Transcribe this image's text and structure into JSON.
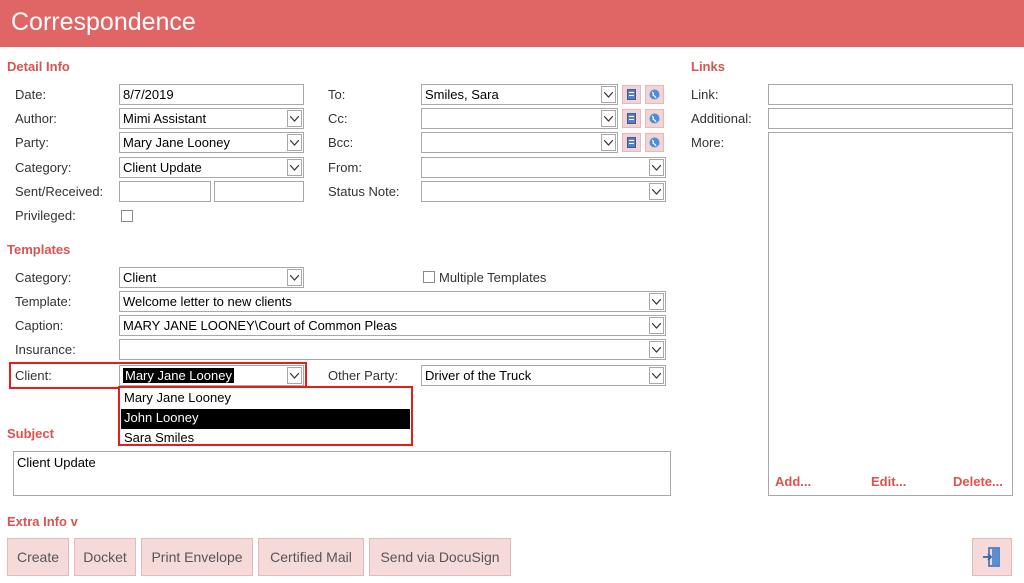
{
  "window": {
    "title": "Correspondence"
  },
  "detail": {
    "heading": "Detail Info",
    "date_label": "Date:",
    "date_value": "8/7/2019",
    "author_label": "Author:",
    "author_value": "Mimi Assistant",
    "party_label": "Party:",
    "party_value": "Mary  Jane Looney",
    "category_label": "Category:",
    "category_value": "Client Update",
    "sent_label": "Sent/Received:",
    "sent_value_1": "",
    "sent_value_2": "",
    "privileged_label": "Privileged:",
    "to_label": "To:",
    "to_value": "Smiles, Sara",
    "cc_label": "Cc:",
    "cc_value": "",
    "bcc_label": "Bcc:",
    "bcc_value": "",
    "from_label": "From:",
    "from_value": "",
    "status_label": "Status Note:",
    "status_value": ""
  },
  "templates": {
    "heading": "Templates",
    "category_label": "Category:",
    "category_value": "Client",
    "multiple_label": "Multiple Templates",
    "template_label": "Template:",
    "template_value": "Welcome letter to new clients",
    "caption_label": "Caption:",
    "caption_value": "MARY JANE LOONEY\\Court of Common Pleas",
    "insurance_label": "Insurance:",
    "insurance_value": "",
    "client_label": "Client:",
    "client_value": "Mary  Jane Looney",
    "other_party_label": "Other Party:",
    "other_party_value": "Driver of the Truck",
    "client_options": [
      "Mary  Jane Looney",
      "John Looney",
      "Sara Smiles"
    ],
    "client_highlighted_index": 1
  },
  "subject": {
    "heading": "Subject",
    "value": "Client Update"
  },
  "links": {
    "heading": "Links",
    "link_label": "Link:",
    "link_value": "",
    "additional_label": "Additional:",
    "additional_value": "",
    "more_label": "More:",
    "add_label": "Add...",
    "edit_label": "Edit...",
    "delete_label": "Delete..."
  },
  "extra": {
    "label": "Extra Info v"
  },
  "toolbar": {
    "create": "Create",
    "docket": "Docket",
    "print_envelope": "Print Envelope",
    "certified_mail": "Certified Mail",
    "send_docusign": "Send via DocuSign",
    "exit_icon": "exit-door-icon"
  },
  "colors": {
    "accent": "#e06666",
    "section": "#d9534f",
    "button_bg": "#f6dada",
    "highlight": "#e02020"
  }
}
